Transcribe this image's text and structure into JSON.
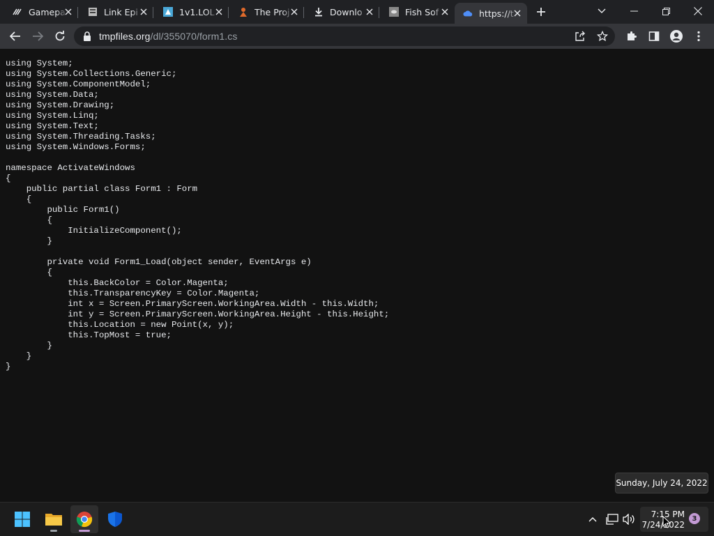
{
  "browser": {
    "tabs": [
      {
        "title": "Gamepa",
        "icon": "gamepad-site-icon"
      },
      {
        "title": "Link Epi",
        "icon": "page-favicon-icon"
      },
      {
        "title": "1v1.LOL",
        "icon": "game-favicon-icon"
      },
      {
        "title": "The Proj",
        "icon": "project-favicon-icon"
      },
      {
        "title": "Downlo",
        "icon": "download-icon"
      },
      {
        "title": "Fish Sof",
        "icon": "fish-favicon-icon"
      },
      {
        "title": "https://t",
        "icon": "cloud-icon",
        "active": true
      }
    ],
    "url_host": "tmpfiles.org",
    "url_path": "/dl/355070/form1.cs"
  },
  "content": {
    "code_lines": [
      "using System;",
      "using System.Collections.Generic;",
      "using System.ComponentModel;",
      "using System.Data;",
      "using System.Drawing;",
      "using System.Linq;",
      "using System.Text;",
      "using System.Threading.Tasks;",
      "using System.Windows.Forms;",
      "",
      "namespace ActivateWindows",
      "{",
      "    public partial class Form1 : Form",
      "    {",
      "        public Form1()",
      "        {",
      "            InitializeComponent();",
      "        }",
      "",
      "        private void Form1_Load(object sender, EventArgs e)",
      "        {",
      "            this.BackColor = Color.Magenta;",
      "            this.TransparencyKey = Color.Magenta;",
      "            int x = Screen.PrimaryScreen.WorkingArea.Width - this.Width;",
      "            int y = Screen.PrimaryScreen.WorkingArea.Height - this.Height;",
      "            this.Location = new Point(x, y);",
      "            this.TopMost = true;",
      "        }",
      "    }",
      "}"
    ]
  },
  "taskbar": {
    "time": "7:15 PM",
    "date": "7/24/2022",
    "tooltip": "Sunday, July 24, 2022",
    "notification_count": "3"
  },
  "colors": {
    "accent": "#c39ad4",
    "content_bg": "#121212",
    "toolbar_bg": "#35363a"
  }
}
